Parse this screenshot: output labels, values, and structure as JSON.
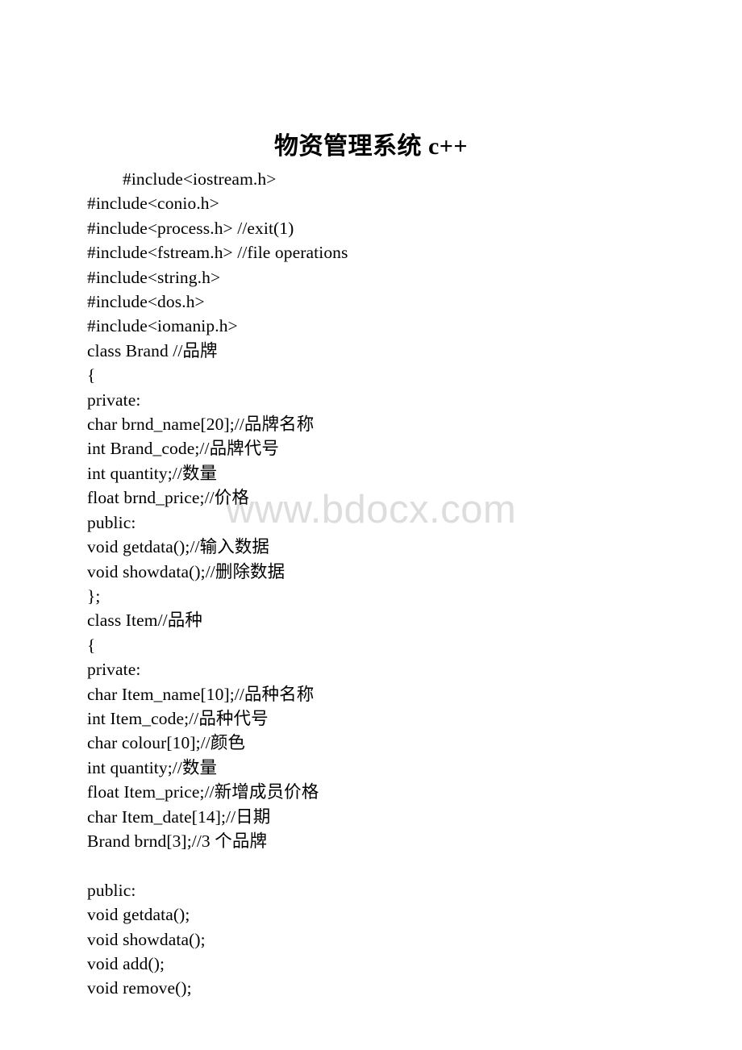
{
  "document": {
    "title": "物资管理系统 c++",
    "watermark": "www.bdocx.com",
    "background_color": "#ffffff",
    "text_color": "#000000",
    "watermark_color": "#dddddd"
  },
  "code": {
    "lines": [
      {
        "text": "#include<iostream.h>",
        "indent": true
      },
      {
        "text": "#include<conio.h>",
        "indent": false
      },
      {
        "text": "#include<process.h> //exit(1)",
        "indent": false
      },
      {
        "text": "#include<fstream.h> //file operations",
        "indent": false
      },
      {
        "text": "#include<string.h>",
        "indent": false
      },
      {
        "text": "#include<dos.h>",
        "indent": false
      },
      {
        "text": "#include<iomanip.h>",
        "indent": false
      },
      {
        "text": "class Brand //品牌",
        "indent": false
      },
      {
        "text": "{",
        "indent": false
      },
      {
        "text": "private:",
        "indent": false
      },
      {
        "text": "char brnd_name[20];//品牌名称",
        "indent": false
      },
      {
        "text": "int Brand_code;//品牌代号",
        "indent": false
      },
      {
        "text": "int quantity;//数量",
        "indent": false
      },
      {
        "text": "float brnd_price;//价格",
        "indent": false
      },
      {
        "text": "public:",
        "indent": false
      },
      {
        "text": "void getdata();//输入数据",
        "indent": false
      },
      {
        "text": "void showdata();//删除数据",
        "indent": false
      },
      {
        "text": "};",
        "indent": false
      },
      {
        "text": "class Item//品种",
        "indent": false
      },
      {
        "text": "{",
        "indent": false
      },
      {
        "text": "private:",
        "indent": false
      },
      {
        "text": "char Item_name[10];//品种名称",
        "indent": false
      },
      {
        "text": "int Item_code;//品种代号",
        "indent": false
      },
      {
        "text": "char colour[10];//颜色",
        "indent": false
      },
      {
        "text": "int quantity;//数量",
        "indent": false
      },
      {
        "text": "float Item_price;//新增成员价格",
        "indent": false
      },
      {
        "text": "char Item_date[14];//日期",
        "indent": false
      },
      {
        "text": "Brand brnd[3];//3 个品牌",
        "indent": false
      },
      {
        "text": "",
        "indent": false
      },
      {
        "text": "public:",
        "indent": false
      },
      {
        "text": "void getdata();",
        "indent": false
      },
      {
        "text": "void showdata();",
        "indent": false
      },
      {
        "text": "void add();",
        "indent": false
      },
      {
        "text": "void remove();",
        "indent": false
      }
    ]
  }
}
